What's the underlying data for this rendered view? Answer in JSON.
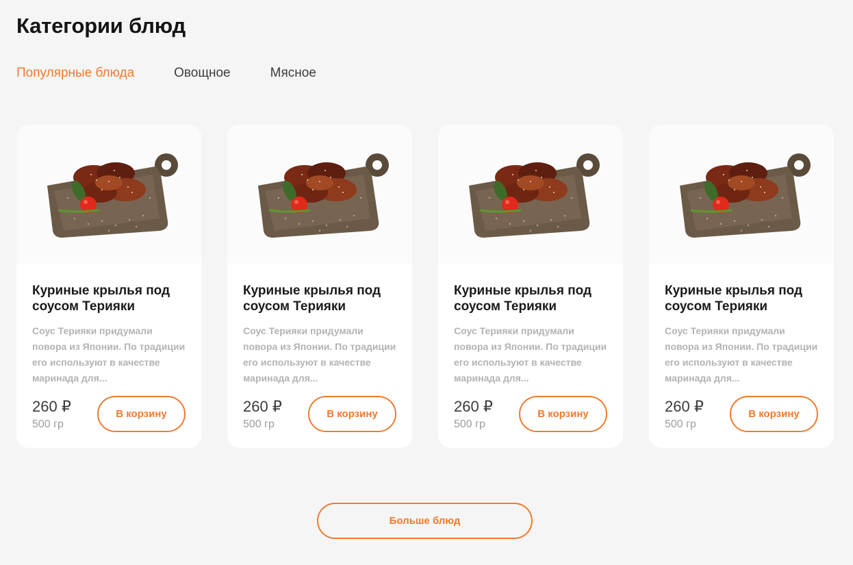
{
  "section": {
    "title": "Категории блюд"
  },
  "tabs": [
    {
      "label": "Популярные блюда",
      "active": true
    },
    {
      "label": "Овощное",
      "active": false
    },
    {
      "label": "Мясное",
      "active": false
    }
  ],
  "cards": [
    {
      "image_icon": "chicken-wings-on-board-image",
      "title_line1": "Куриные крылья под",
      "title_line2": "соусом Терияки",
      "description": "Соус Терияки придумали повора из Японии. По традиции его используют в качестве маринада для...",
      "price": "260 ₽",
      "weight": "500 гр",
      "button_label": "В корзину"
    },
    {
      "image_icon": "chicken-wings-on-board-image",
      "title_line1": "Куриные крылья под",
      "title_line2": "соусом Терияки",
      "description": "Соус Терияки придумали повора из Японии. По традиции его используют в качестве маринада для...",
      "price": "260 ₽",
      "weight": "500 гр",
      "button_label": "В корзину"
    },
    {
      "image_icon": "chicken-wings-on-board-image",
      "title_line1": "Куриные крылья под",
      "title_line2": "соусом Терияки",
      "description": "Соус Терияки придумали повора из Японии. По традиции его используют в качестве маринада для...",
      "price": "260 ₽",
      "weight": "500 гр",
      "button_label": "В корзину"
    },
    {
      "image_icon": "chicken-wings-on-board-image",
      "title_line1": "Куриные крылья под",
      "title_line2": "соусом Терияки",
      "description": "Соус Терияки придумали повора из Японии. По традиции его используют в качестве маринада для...",
      "price": "260 ₽",
      "weight": "500 гр",
      "button_label": "В корзину"
    }
  ],
  "more_button": {
    "label": "Больше блюд"
  },
  "colors": {
    "accent": "#f07a2e",
    "background": "#f5f5f5",
    "card": "#ffffff",
    "muted": "#b3b3b3"
  }
}
